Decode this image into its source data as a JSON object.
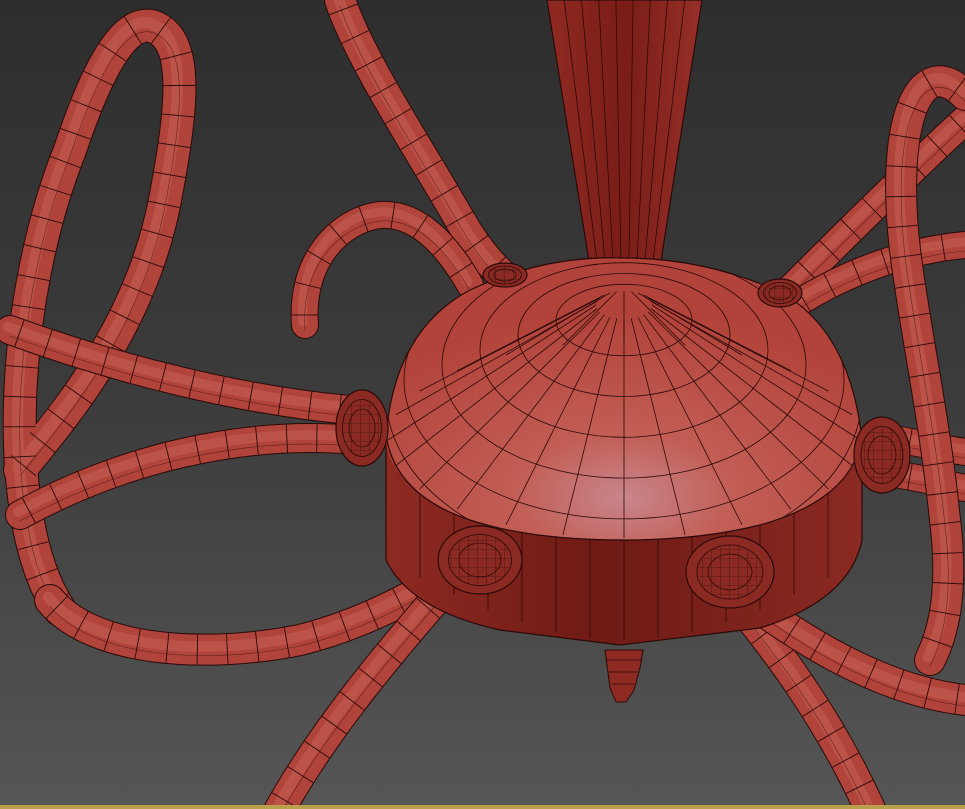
{
  "viewport": {
    "description_icon": "3d-wireframe-viewport-icon",
    "colors": {
      "background_top": "#2e2e2e",
      "background_mid": "#3c3c3c",
      "background_bottom": "#565656",
      "object_fill": "#b8463c",
      "object_dark": "#7a1f1a",
      "object_light": "#c45a52",
      "object_highlight": "#c9868c",
      "wire": "#2a0a08",
      "status_strip": "#b8a14a"
    }
  }
}
